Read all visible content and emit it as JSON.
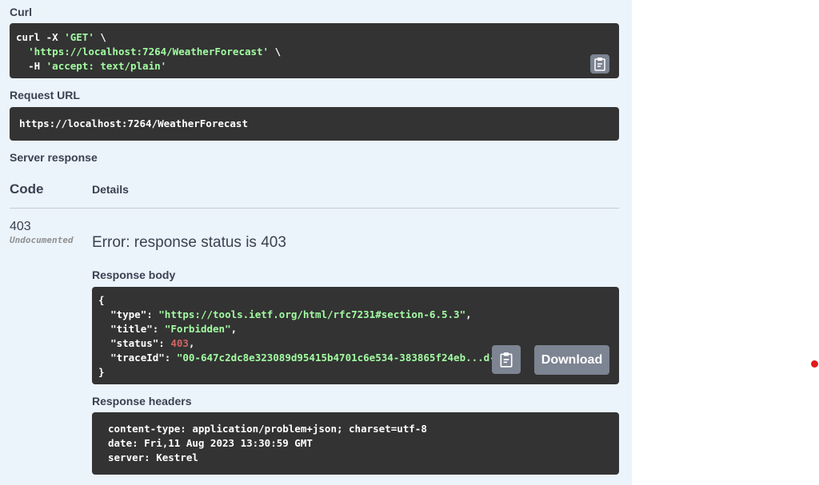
{
  "curl": {
    "label": "Curl",
    "cmd1": "curl -X ",
    "method": "'GET'",
    "slash": " \\",
    "url": "'https://localhost:7264/WeatherForecast'",
    "h_flag": "-H ",
    "header": "'accept: text/plain'"
  },
  "request_url": {
    "label": "Request URL",
    "value": "https://localhost:7264/WeatherForecast"
  },
  "server_response": {
    "label": "Server response",
    "col_code": "Code",
    "col_details": "Details",
    "code": "403",
    "undocumented": "Undocumented",
    "error_text": "Error: response status is 403"
  },
  "response_body": {
    "label": "Response body",
    "open_brace": "{",
    "close_brace": "}",
    "type_key": "\"type\"",
    "type_val": "\"https://tools.ietf.org/html/rfc7231#section-6.5.3\"",
    "title_key": "\"title\"",
    "title_val": "\"Forbidden\"",
    "status_key": "\"status\"",
    "status_val": "403",
    "trace_key": "\"traceId\"",
    "trace_val": "\"00-647c2dc8e323089d95415b4701c6e534-383865f24eb...d-00\"",
    "download_label": "Download"
  },
  "response_headers": {
    "label": "Response headers",
    "line1": "content-type: application/problem+json; charset=utf-8",
    "line2": "date: Fri,11 Aug 2023 13:30:59 GMT",
    "line3": "server: Kestrel"
  },
  "icons": {
    "copy": "clipboard-icon"
  },
  "colors": {
    "panel_bg": "#ebf3fb",
    "code_bg": "#333333",
    "string": "#a2fca2",
    "number": "#d36363",
    "button": "#7d8492",
    "marker": "#e01b1b"
  }
}
